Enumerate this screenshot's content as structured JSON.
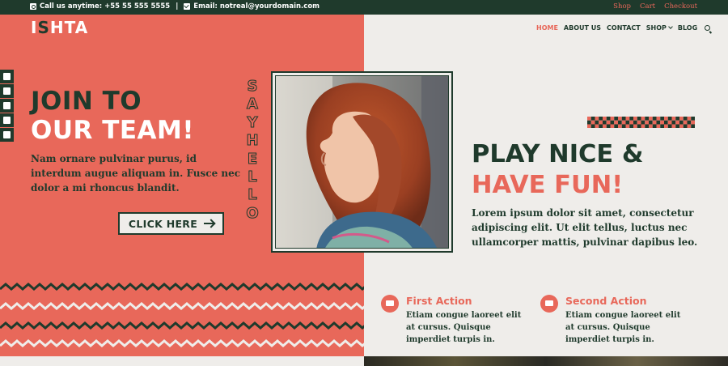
{
  "topbar": {
    "phone_text": "Call us anytime: +55 55 555 5555",
    "separator": "|",
    "email_text": "Email: notreal@yourdomain.com",
    "links": [
      "Shop",
      "Cart",
      "Checkout"
    ]
  },
  "logo": {
    "part1": "I",
    "part2": "S",
    "part3": "HTA"
  },
  "nav": {
    "items": [
      "HOME",
      "ABOUT US",
      "CONTACT",
      "SHOP",
      "BLOG"
    ],
    "active": "HOME"
  },
  "social": [
    "facebook-icon",
    "twitter-icon",
    "youtube-icon",
    "instagram-icon",
    "email-icon"
  ],
  "hero_left": {
    "heading_line1": "JOIN TO",
    "heading_line2": "OUR TEAM!",
    "body": "Nam ornare pulvinar purus, id interdum augue aliquam in. Fusce nec dolor a mi rhoncus blandit.",
    "cta_label": "CLICK HERE",
    "vertical_text": [
      "S",
      "A",
      "Y",
      "H",
      "E",
      "L",
      "L",
      "O"
    ]
  },
  "hero_right": {
    "heading_line1": "PLAY NICE &",
    "heading_line2": "HAVE FUN!",
    "body": "Lorem ipsum dolor sit amet, consectetur adipiscing elit. Ut elit tellus, luctus nec ullamcorper mattis, pulvinar dapibus leo."
  },
  "features": [
    {
      "title": "First Action",
      "text": "Etiam congue laoreet elit at cursus. Quisque imperdiet turpis in.",
      "icon": "megaphone-icon"
    },
    {
      "title": "Second Action",
      "text": "Etiam congue laoreet elit at cursus. Quisque imperdiet turpis in.",
      "icon": "truck-icon"
    }
  ],
  "colors": {
    "coral": "#e8685a",
    "dark_green": "#1f3a2c",
    "cream": "#efedea"
  }
}
